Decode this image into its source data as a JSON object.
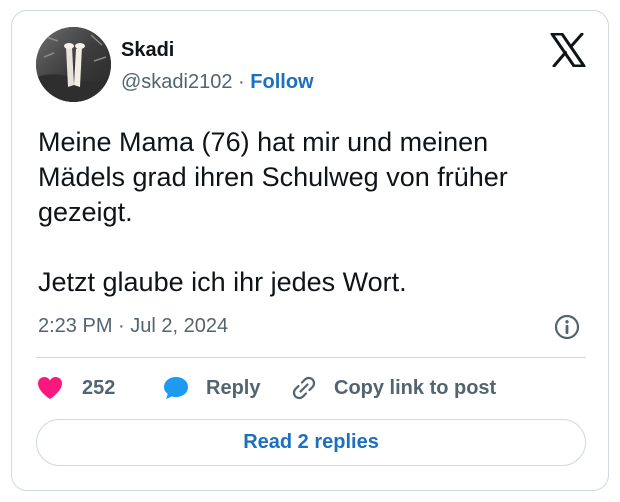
{
  "author": {
    "display_name": "Skadi",
    "handle": "@skadi2102",
    "separator": "·",
    "follow_label": "Follow",
    "avatar_icon": "avatar-legs-photo"
  },
  "brand": {
    "logo_icon": "x-logo-icon"
  },
  "tweet": {
    "text": "Meine Mama (76) hat mir und meinen Mädels grad ihren Schulweg von früher gezeigt.\n\nJetzt glaube ich ihr jedes Wort.",
    "timestamp": "2:23 PM · Jul 2, 2024",
    "info_icon": "info-icon"
  },
  "actions": {
    "like": {
      "icon": "heart-icon",
      "count": "252",
      "color": "#f91880"
    },
    "reply": {
      "icon": "speech-bubble-icon",
      "label": "Reply",
      "color": "#1d9bf0"
    },
    "copy_link": {
      "icon": "link-icon",
      "label": "Copy link to post"
    }
  },
  "read_replies": {
    "label": "Read 2 replies"
  },
  "colors": {
    "text_primary": "#0f1419",
    "text_secondary": "#536471",
    "accent_link": "#1d6fbf",
    "border": "#cfd9de"
  }
}
